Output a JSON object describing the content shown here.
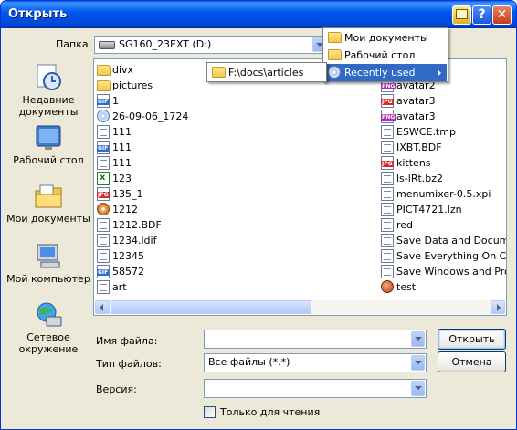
{
  "window": {
    "title": "Открыть"
  },
  "lookin": {
    "label": "Папка:",
    "value": "SG160_23EXT (D:)"
  },
  "places": [
    {
      "label": "Недавние документы",
      "icon": "recent-docs-icon"
    },
    {
      "label": "Рабочий стол",
      "icon": "desktop-icon"
    },
    {
      "label": "Мои документы",
      "icon": "my-documents-icon"
    },
    {
      "label": "Мой компьютер",
      "icon": "my-computer-icon"
    },
    {
      "label": "Сетевое окружение",
      "icon": "network-places-icon"
    }
  ],
  "files_left": [
    {
      "name": "divx",
      "type": "folder"
    },
    {
      "name": "pictures",
      "type": "folder"
    },
    {
      "name": "1",
      "type": "gif"
    },
    {
      "name": "26-09-06_1724",
      "type": "cd"
    },
    {
      "name": "111",
      "type": "doc"
    },
    {
      "name": "111",
      "type": "gif"
    },
    {
      "name": "111",
      "type": "txt"
    },
    {
      "name": "123",
      "type": "xls"
    },
    {
      "name": "135_1",
      "type": "jpg"
    },
    {
      "name": "1212",
      "type": "cd-orange"
    },
    {
      "name": "1212.BDF",
      "type": "doc"
    },
    {
      "name": "1234.ldif",
      "type": "doc"
    },
    {
      "name": "12345",
      "type": "txt"
    },
    {
      "name": "58572",
      "type": "gif"
    },
    {
      "name": "art",
      "type": "doc"
    }
  ],
  "files_right": [
    {
      "name": "avatar2",
      "type": "png"
    },
    {
      "name": "avatar3",
      "type": "jpg"
    },
    {
      "name": "avatar3",
      "type": "png"
    },
    {
      "name": "ESWCE.tmp",
      "type": "doc"
    },
    {
      "name": "IXBT.BDF",
      "type": "doc"
    },
    {
      "name": "kittens",
      "type": "jpg"
    },
    {
      "name": "ls-lRt.bz2",
      "type": "doc"
    },
    {
      "name": "menumixer-0.5.xpi",
      "type": "doc"
    },
    {
      "name": "PICT4721.lzn",
      "type": "doc"
    },
    {
      "name": "red",
      "type": "txt"
    },
    {
      "name": "Save Data and Document",
      "type": "doc"
    },
    {
      "name": "Save Everything On Com",
      "type": "doc"
    },
    {
      "name": "Save Windows and Progr",
      "type": "doc"
    },
    {
      "name": "test",
      "type": "web"
    }
  ],
  "form": {
    "filename_label": "Имя файла:",
    "filename_value": "",
    "filetype_label": "Тип файлов:",
    "filetype_value": "Все файлы (*.*)",
    "version_label": "Версия:",
    "version_value": "",
    "readonly_label": "Только для чтения"
  },
  "buttons": {
    "open": "Открыть",
    "cancel": "Отмена"
  },
  "menu": {
    "items": [
      {
        "label": "Мои документы",
        "icon": "folder-icon"
      },
      {
        "label": "Рабочий стол",
        "icon": "folder-icon"
      },
      {
        "label": "Recently used",
        "icon": "clock-icon"
      }
    ],
    "submenu_item": "F:\\docs\\articles"
  },
  "colors": {
    "titlebar": "#0058EE",
    "selection": "#316AC5",
    "dialog_bg": "#ECE9D8"
  }
}
